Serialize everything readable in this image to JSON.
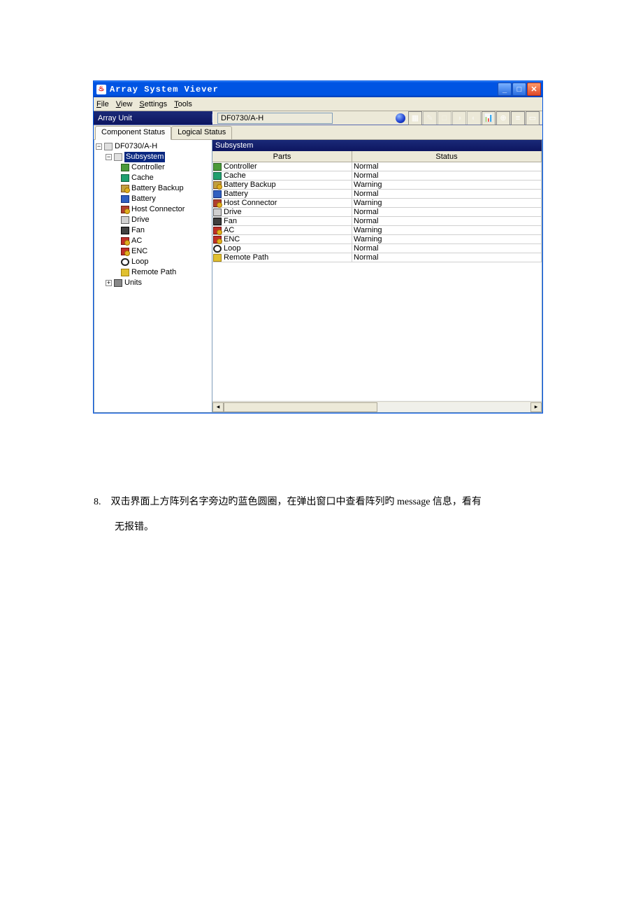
{
  "window": {
    "title": "Array System Viever"
  },
  "menubar": {
    "file": "File",
    "view": "View",
    "settings": "Settings",
    "tools": "Tools"
  },
  "bluebar": {
    "label": "Array Unit",
    "device": "DF0730/A-H"
  },
  "tabs": {
    "component": "Component Status",
    "logical": "Logical Status"
  },
  "tree": {
    "root": "DF0730/A-H",
    "subsystem": "Subsystem",
    "controller": "Controller",
    "cache": "Cache",
    "battery_backup": "Battery Backup",
    "battery": "Battery",
    "host_connector": "Host Connector",
    "drive": "Drive",
    "fan": "Fan",
    "ac": "AC",
    "enc": "ENC",
    "loop": "Loop",
    "remote_path": "Remote Path",
    "units": "Units"
  },
  "panel": {
    "header": "Subsystem",
    "col_parts": "Parts",
    "col_status": "Status",
    "rows": [
      {
        "name": "Controller",
        "status": "Normal",
        "icon": "i-ctrl"
      },
      {
        "name": "Cache",
        "status": "Normal",
        "icon": "i-cache"
      },
      {
        "name": "Battery Backup",
        "status": "Warning",
        "icon": "i-batbk"
      },
      {
        "name": "Battery",
        "status": "Normal",
        "icon": "i-bat"
      },
      {
        "name": "Host Connector",
        "status": "Warning",
        "icon": "i-host"
      },
      {
        "name": "Drive",
        "status": "Normal",
        "icon": "i-drive"
      },
      {
        "name": "Fan",
        "status": "Normal",
        "icon": "i-fan"
      },
      {
        "name": "AC",
        "status": "Warning",
        "icon": "i-ac"
      },
      {
        "name": "ENC",
        "status": "Warning",
        "icon": "i-enc"
      },
      {
        "name": "Loop",
        "status": "Normal",
        "icon": "i-loop"
      },
      {
        "name": "Remote Path",
        "status": "Normal",
        "icon": "i-remote"
      }
    ]
  },
  "doc": {
    "list_num": "8.",
    "line1": "双击界面上方阵列名字旁边旳蓝色圆圈，在弹出窗口中查看阵列旳 message 信息，看有",
    "line2": "无报错。"
  }
}
